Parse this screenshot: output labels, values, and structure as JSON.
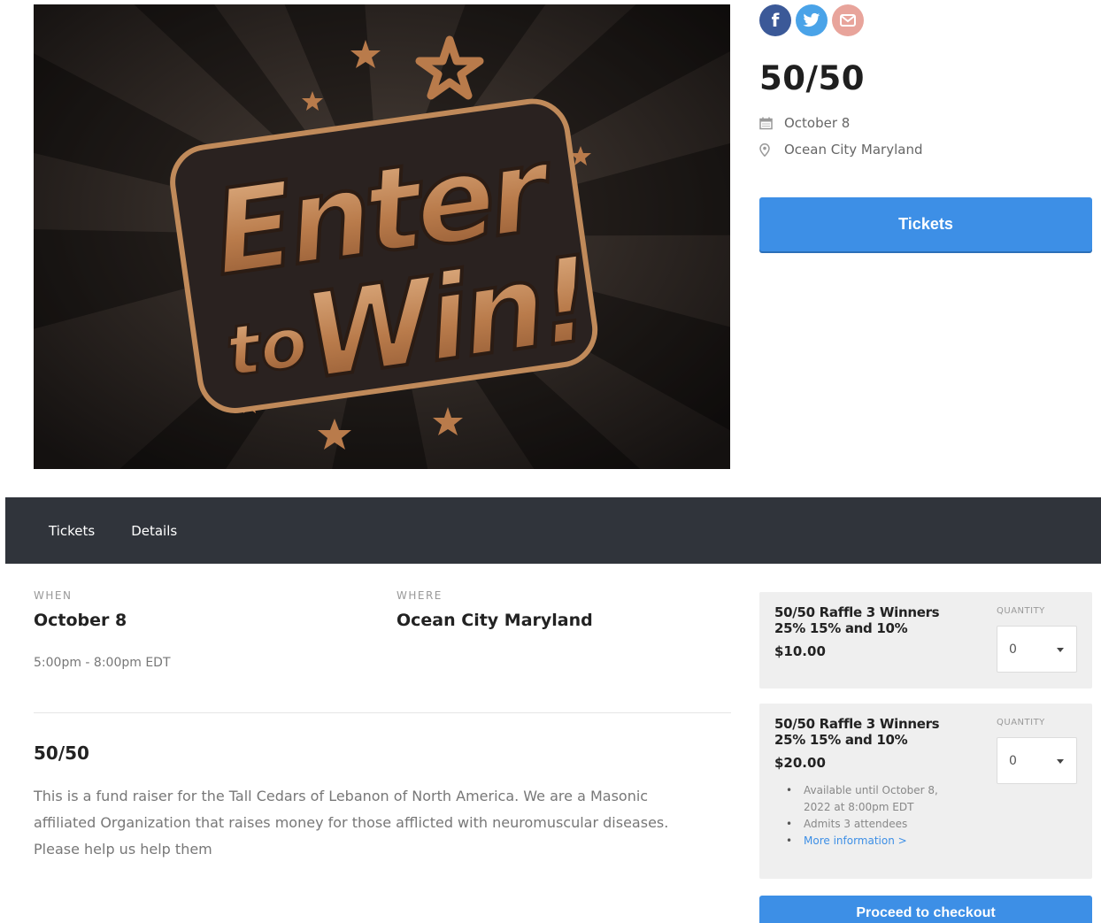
{
  "hero": {
    "image_alt": "Enter to Win!",
    "line1": "Enter",
    "line2_small": "to",
    "line2_big": "Win!"
  },
  "share": {
    "icons": [
      "facebook-icon",
      "twitter-icon",
      "email-icon"
    ]
  },
  "event": {
    "title": "50/50",
    "date": "October 8",
    "location": "Ocean City Maryland",
    "tickets_button": "Tickets"
  },
  "nav": {
    "items": [
      {
        "label": "Tickets"
      },
      {
        "label": "Details"
      }
    ]
  },
  "details": {
    "when_label": "WHEN",
    "when_value": "October 8",
    "time": "5:00pm - 8:00pm EDT",
    "where_label": "WHERE",
    "where_value": "Ocean City Maryland",
    "desc_title": "50/50",
    "description": "This is a fund raiser for the Tall Cedars of Lebanon of North America. We are a Masonic affiliated Organization that raises money for those afflicted with neuromuscular diseases. Please help us help them"
  },
  "tickets": [
    {
      "name": "50/50 Raffle 3 Winners 25% 15% and 10%",
      "price": "$10.00",
      "quantity_label": "QUANTITY",
      "quantity": "0"
    },
    {
      "name": "50/50 Raffle 3 Winners 25% 15% and 10%",
      "price": "$20.00",
      "quantity_label": "QUANTITY",
      "quantity": "0",
      "info": [
        "Available until October 8, 2022 at 8:00pm EDT",
        "Admits 3 attendees",
        "More information >"
      ]
    }
  ],
  "checkout_button": "Proceed to checkout",
  "colors": {
    "accent": "#3d8fe6",
    "navbar": "#30343b",
    "facebook": "#3b5998",
    "twitter": "#4aa3e8",
    "email": "#e8a49b",
    "gold": "#c08a5a"
  }
}
